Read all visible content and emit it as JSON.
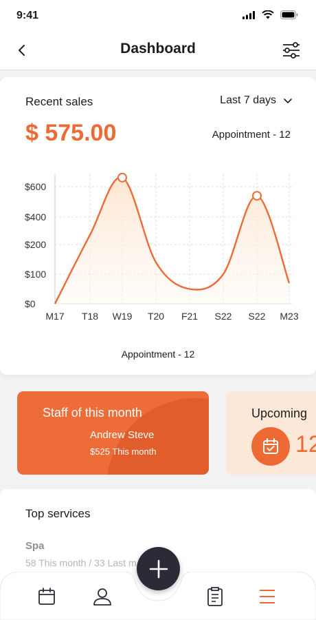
{
  "status_bar": {
    "time": "9:41"
  },
  "nav": {
    "title": "Dashboard",
    "back_icon": "chevron-left-icon",
    "filter_icon": "sliders-icon"
  },
  "sales": {
    "title": "Recent sales",
    "range_label": "Last 7 days",
    "amount": "$ 575.00",
    "appointment_top": "Appointment - 12",
    "appointment_bottom": "Appointment - 12"
  },
  "chart_data": {
    "type": "line",
    "categories": [
      "M17",
      "T18",
      "W19",
      "T20",
      "F21",
      "S22",
      "S22",
      "M23"
    ],
    "y_tick_labels": [
      "$0",
      "$100",
      "$200",
      "$400",
      "$600"
    ],
    "y_ticks": [
      0,
      100,
      200,
      400,
      600
    ],
    "series": [
      {
        "values": [
          0,
          270,
          660,
          140,
          50,
          100,
          540,
          70
        ],
        "highlighted_points": [
          2,
          6
        ]
      }
    ],
    "colors": {
      "line": "#ee6a34",
      "fill": "#fde7d3"
    },
    "grid": true
  },
  "staff": {
    "heading": "Staff of this month",
    "name": "Andrew Steve",
    "amount": "$525 This month"
  },
  "upcoming": {
    "heading": "Upcoming",
    "count": "12",
    "icon": "calendar-check-icon"
  },
  "services": {
    "title": "Top services",
    "items": [
      {
        "name": "Spa",
        "stats": "58 This month / 33 Last m"
      }
    ]
  },
  "tab_bar": {
    "items": [
      "calendar-icon",
      "user-icon",
      "clipboard-icon",
      "menu-icon"
    ],
    "active": "menu-icon",
    "fab_icon": "plus-icon"
  },
  "colors": {
    "accent": "#ee6a34",
    "dark": "#2b2a37",
    "staff_card": "#ee6c38"
  }
}
